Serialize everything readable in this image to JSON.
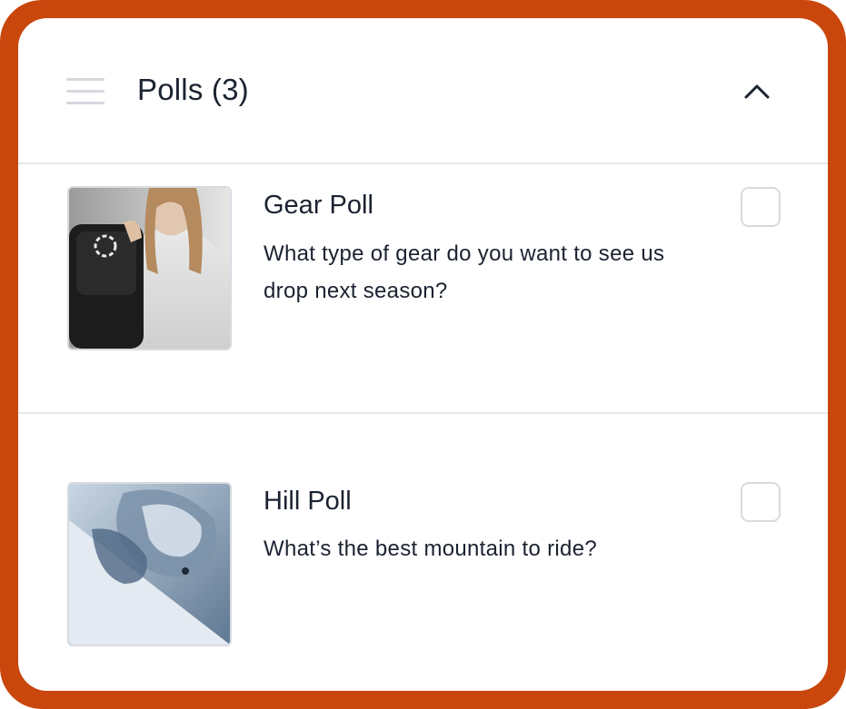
{
  "header": {
    "title": "Polls (3)",
    "drag_icon": "drag-handle-icon",
    "collapse_icon": "chevron-up-icon"
  },
  "polls": [
    {
      "title": "Gear Poll",
      "description": "What type of gear do you want to see us drop next season?",
      "image": "snowboard-gear-photo",
      "checked": false
    },
    {
      "title": "Hill Poll",
      "description": "What’s the best mountain to ride?",
      "image": "snowboarder-powder-photo",
      "checked": false
    }
  ],
  "colors": {
    "frame": "#c9460c",
    "text": "#1b2230",
    "divider": "#e6e8eb"
  }
}
